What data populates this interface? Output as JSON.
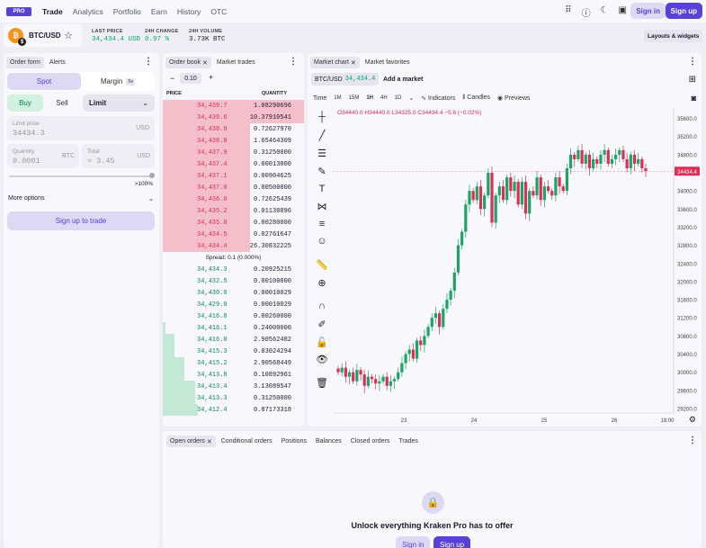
{
  "nav": {
    "logo": "PRO",
    "links": [
      "Trade",
      "Analytics",
      "Portfolio",
      "Earn",
      "History",
      "OTC"
    ],
    "signin": "Sign in",
    "signup": "Sign up"
  },
  "ticker": {
    "pair": "BTC/USD",
    "coin_letter": "₿",
    "last_price_label": "LAST PRICE",
    "last_price": "34,434.4 USD",
    "change_label": "24H CHANGE",
    "change": "0.97 %",
    "volume_label": "24H VOLUME",
    "volume": "3.73K BTC",
    "layouts": "Layouts & widgets"
  },
  "order_form": {
    "tabs": [
      "Order form",
      "Alerts"
    ],
    "spot": "Spot",
    "margin": "Margin",
    "margin_badge": "5x",
    "buy": "Buy",
    "sell": "Sell",
    "order_type": "Limit",
    "limit_price_label": "Limit price",
    "limit_price": "34434.3",
    "limit_price_unit": "USD",
    "quantity_label": "Quantity",
    "quantity": "0.0001",
    "quantity_unit": "BTC",
    "total_label": "Total",
    "total": "≈ 3.45",
    "total_unit": "USD",
    "slider_max": ">100%",
    "more_options": "More options",
    "signup_trade": "Sign up to trade"
  },
  "order_book": {
    "tabs": [
      "Order book",
      "Market trades"
    ],
    "tick": "0.10",
    "price_header": "PRICE",
    "qty_header": "QUANTITY",
    "asks": [
      {
        "price": "34,439.7",
        "qty": "1.08290696",
        "depth": 1.0
      },
      {
        "price": "34,439.6",
        "qty": "10.37910541",
        "depth": 1.0
      },
      {
        "price": "34,438.9",
        "qty": "0.72627970",
        "depth": 0.62
      },
      {
        "price": "34,438.8",
        "qty": "1.65464309",
        "depth": 0.62
      },
      {
        "price": "34,437.9",
        "qty": "0.31250000",
        "depth": 0.62
      },
      {
        "price": "34,437.4",
        "qty": "0.00013800",
        "depth": 0.62
      },
      {
        "price": "34,437.1",
        "qty": "0.00904625",
        "depth": 0.62
      },
      {
        "price": "34,437.0",
        "qty": "0.00500000",
        "depth": 0.62
      },
      {
        "price": "34,436.0",
        "qty": "0.72625439",
        "depth": 0.62
      },
      {
        "price": "34,435.2",
        "qty": "0.01130896",
        "depth": 0.62
      },
      {
        "price": "34,435.0",
        "qty": "0.00280000",
        "depth": 0.62
      },
      {
        "price": "34,434.5",
        "qty": "0.02761647",
        "depth": 0.62
      },
      {
        "price": "34,434.4",
        "qty": "26.30832225",
        "depth": 0.62
      }
    ],
    "spread": "Spread: 0.1 (0.000%)",
    "bids": [
      {
        "price": "34,434.3",
        "qty": "0.20925215",
        "depth": 0.0
      },
      {
        "price": "34,432.5",
        "qty": "0.00100000",
        "depth": 0.0
      },
      {
        "price": "34,430.0",
        "qty": "0.00010029",
        "depth": 0.0
      },
      {
        "price": "34,429.0",
        "qty": "0.00010029",
        "depth": 0.0
      },
      {
        "price": "34,416.8",
        "qty": "0.00260000",
        "depth": 0.0
      },
      {
        "price": "34,416.1",
        "qty": "0.24000000",
        "depth": 0.02
      },
      {
        "price": "34,416.0",
        "qty": "2.90562482",
        "depth": 0.08
      },
      {
        "price": "34,415.3",
        "qty": "0.03024294",
        "depth": 0.08
      },
      {
        "price": "34,415.2",
        "qty": "2.90568449",
        "depth": 0.15
      },
      {
        "price": "34,413.8",
        "qty": "0.10892961",
        "depth": 0.15
      },
      {
        "price": "34,413.4",
        "qty": "3.13089547",
        "depth": 0.23
      },
      {
        "price": "34,413.3",
        "qty": "0.31250000",
        "depth": 0.23
      },
      {
        "price": "34,412.4",
        "qty": "0.87173318",
        "depth": 0.25
      }
    ]
  },
  "chart": {
    "tabs": [
      "Market chart",
      "Market favorites"
    ],
    "pair": "BTC/USD",
    "pair_price": "34,434.4",
    "add_market": "Add a market",
    "time_label": "Time",
    "intervals": [
      "1M",
      "15M",
      "1H",
      "4H",
      "1D"
    ],
    "active_interval": "1H",
    "indicators": "Indicators",
    "candles": "Candles",
    "previews": "Previews",
    "ohlc_text": "O34440.0  H34440.0  L34325.0  C34434.4  −5.6 (−0.02%)",
    "y_ticks": [
      "35600.0",
      "35200.0",
      "34800.0",
      "34400.0",
      "34000.0",
      "33600.0",
      "33200.0",
      "32800.0",
      "32400.0",
      "32000.0",
      "31600.0",
      "31200.0",
      "30800.0",
      "30400.0",
      "30000.0",
      "29600.0",
      "29200.0"
    ],
    "x_ticks": [
      "23",
      "24",
      "25",
      "26",
      "18:00"
    ],
    "last_tag": "34434.4",
    "colors": {
      "up": "#1aa567",
      "down": "#dd2e56",
      "last_line": "#f08aa0"
    },
    "chart_data": {
      "type": "candlestick",
      "y_range": [
        29100,
        35850
      ],
      "series_close": [
        30000,
        30100,
        29900,
        30000,
        29800,
        30050,
        29950,
        29700,
        29900,
        29850,
        29750,
        29800,
        29900,
        29700,
        29800,
        29850,
        30000,
        30200,
        30400,
        30500,
        30300,
        30700,
        30600,
        30800,
        31000,
        31200,
        31300,
        31000,
        31400,
        31600,
        31800,
        32200,
        32800,
        33100,
        33700,
        34000,
        33800,
        34100,
        33600,
        33900,
        34400,
        33300,
        33900,
        34100,
        33800,
        34300,
        34000,
        34200,
        33700,
        34200,
        33500,
        34000,
        33900,
        34300,
        33800,
        34100,
        34000,
        33900,
        34300,
        34100,
        34000,
        34500,
        34800,
        34700,
        34900,
        34600,
        34800,
        34500,
        34700,
        34600,
        34800,
        34900,
        34600,
        34700,
        34800,
        34900,
        34700,
        34500,
        34800,
        34600,
        34700,
        34500,
        34434
      ]
    }
  },
  "bottom": {
    "tabs": [
      "Open orders",
      "Conditional orders",
      "Positions",
      "Balances",
      "Closed orders",
      "Trades"
    ],
    "unlock_text": "Unlock everything Kraken Pro has to offer",
    "signin": "Sign in",
    "signup": "Sign up"
  }
}
